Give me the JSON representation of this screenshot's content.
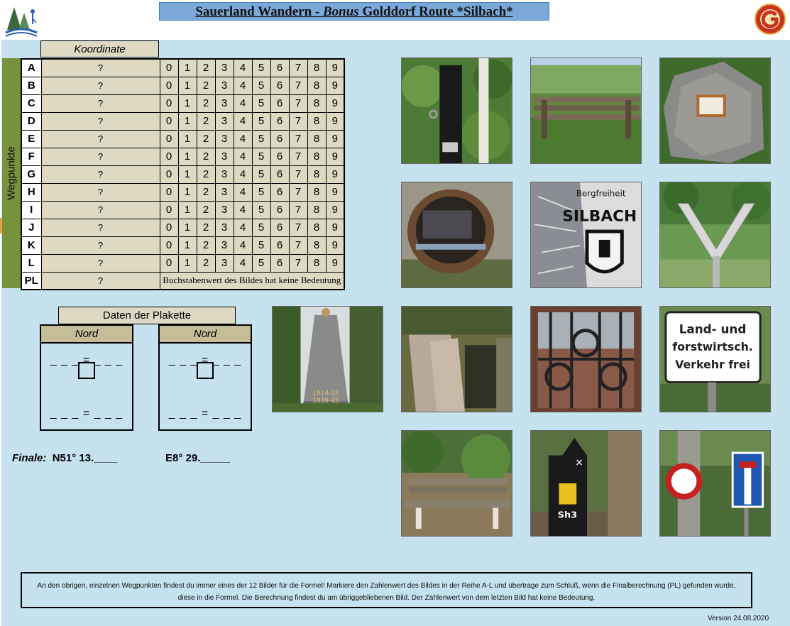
{
  "title": {
    "part1": "Sauerland Wandern - ",
    "part2": "Bonus",
    "part3": " Golddorf Route *Silbach*"
  },
  "koordinate_header": "Koordinate",
  "wegpunkte_label": "Wegpunkte",
  "rows": [
    {
      "letter": "A",
      "coord": "?"
    },
    {
      "letter": "B",
      "coord": "?"
    },
    {
      "letter": "C",
      "coord": "?"
    },
    {
      "letter": "D",
      "coord": "?"
    },
    {
      "letter": "E",
      "coord": "?"
    },
    {
      "letter": "F",
      "coord": "?"
    },
    {
      "letter": "G",
      "coord": "?"
    },
    {
      "letter": "H",
      "coord": "?"
    },
    {
      "letter": "I",
      "coord": "?"
    },
    {
      "letter": "J",
      "coord": "?"
    },
    {
      "letter": "K",
      "coord": "?"
    },
    {
      "letter": "L",
      "coord": "?"
    }
  ],
  "digits": [
    "0",
    "1",
    "2",
    "3",
    "4",
    "5",
    "6",
    "7",
    "8",
    "9"
  ],
  "pl_row": {
    "letter": "PL",
    "coord": "?",
    "note": "Buchstabenwert des Bildes hat keine Bedeutung"
  },
  "plakette": {
    "header": "Daten der Plakette",
    "left_title": "Nord",
    "right_title": "Nord",
    "formula_top": "_ _ _ = _ _ _",
    "formula_bottom": "_ _ _ = _ _ _"
  },
  "finale": {
    "label": "Finale:",
    "north": "N51° 13.____",
    "east": "E8° 29._____"
  },
  "photos": [
    "pipe-post",
    "bench-view",
    "stone-plaque",
    "tunnel-hatch",
    "silbach-sign",
    "v-sculpture",
    "war-memorial",
    "cave-entrance",
    "window-grille",
    "traffic-sign-land-forst",
    "bench-forest",
    "post-marker-sh3",
    "no-entry-dead-end-signs"
  ],
  "photo_text": {
    "sign_line1": "Land- und",
    "sign_line2": "forstwirtsch.",
    "sign_line3": "Verkehr frei",
    "silbach_top": "Bergfreiheit",
    "silbach_name": "SILBACH",
    "memorial_years1": "1914-18",
    "memorial_years2": "1939-45",
    "marker_code": "Sh3"
  },
  "info_text": "An den obrigen, einzelnen Wegpunkten findest du immer eines der 12 Bilder für die Formel! Markiere  den Zahlenwert des Bildes in der Reihe A-L und übertrage zum Schluß, wenn die Finalberechnung (PL) gefunden wurde, diese in die Formel. Die Berechnung findest du am übriggebliebenen  Bild. Der Zahlenwert von dem letzten Bild hat keine Bedeutung.",
  "version": "Version 24.08.2020"
}
